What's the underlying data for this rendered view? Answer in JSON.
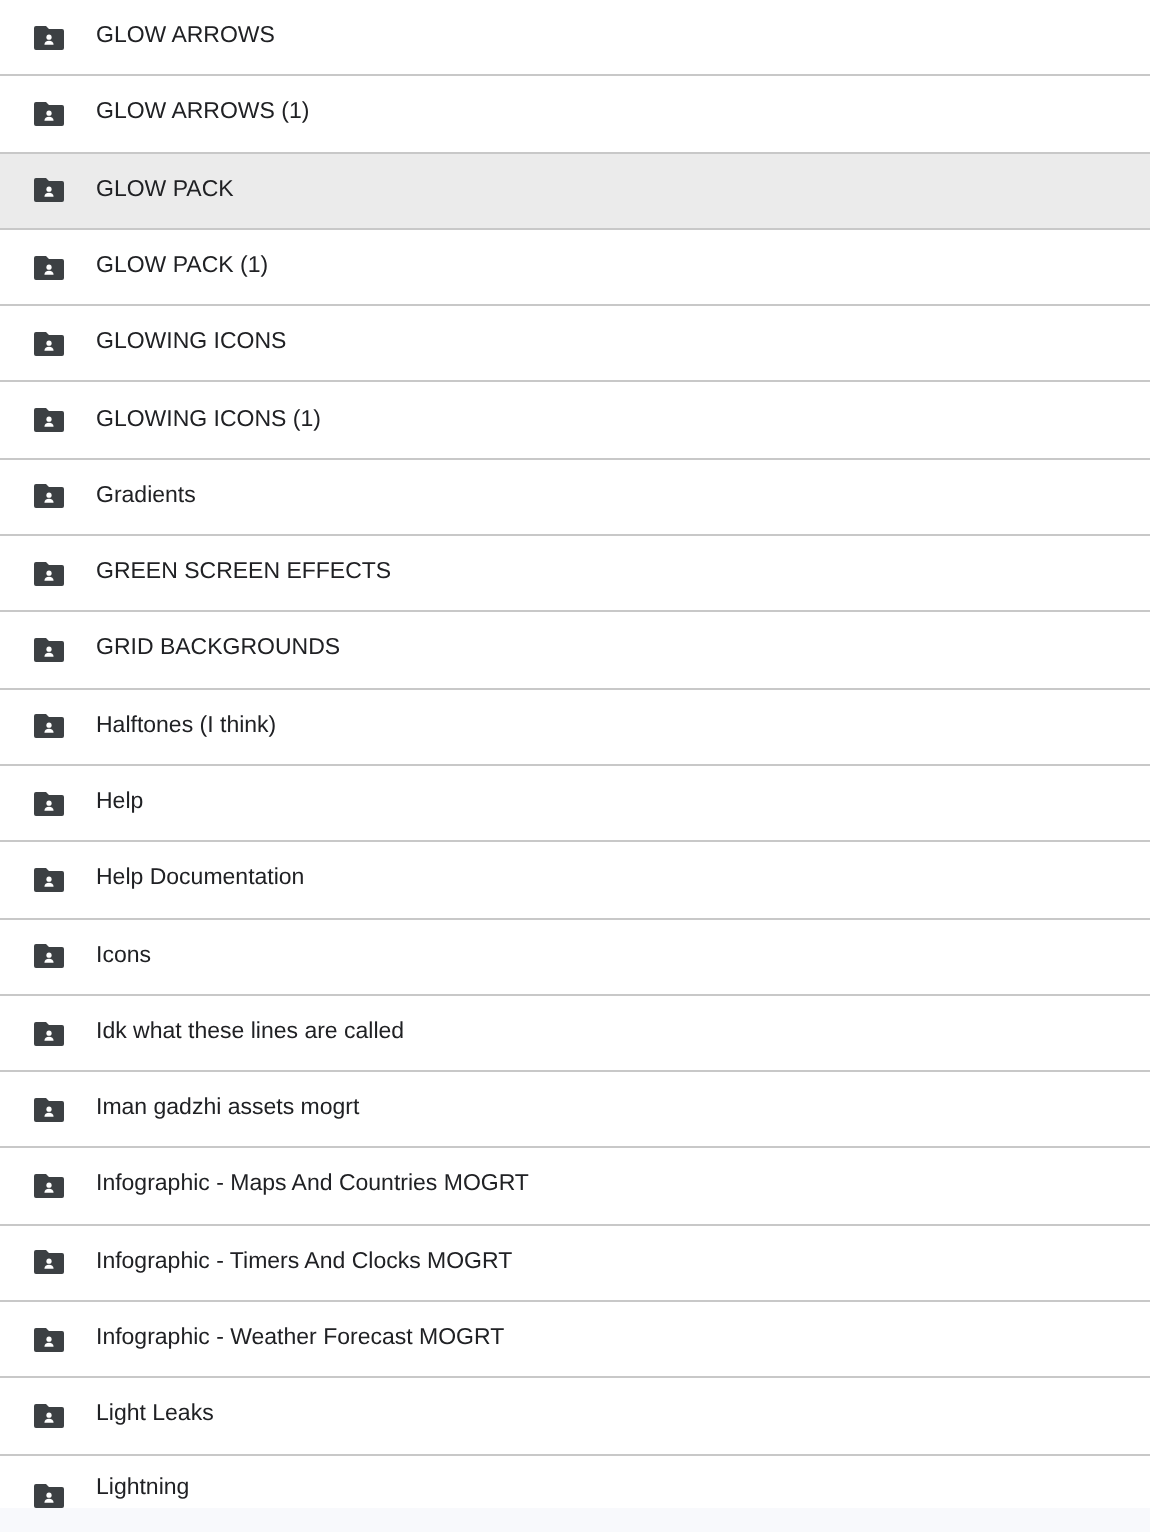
{
  "folders": [
    {
      "name": "GLOW ARROWS",
      "selected": false
    },
    {
      "name": "GLOW ARROWS (1)",
      "selected": false
    },
    {
      "name": "GLOW PACK",
      "selected": true
    },
    {
      "name": "GLOW PACK (1)",
      "selected": false
    },
    {
      "name": "GLOWING ICONS",
      "selected": false
    },
    {
      "name": "GLOWING ICONS (1)",
      "selected": false
    },
    {
      "name": "Gradients",
      "selected": false
    },
    {
      "name": "GREEN SCREEN EFFECTS",
      "selected": false
    },
    {
      "name": "GRID BACKGROUNDS",
      "selected": false
    },
    {
      "name": "Halftones (I think)",
      "selected": false
    },
    {
      "name": "Help",
      "selected": false
    },
    {
      "name": "Help Documentation",
      "selected": false
    },
    {
      "name": "Icons",
      "selected": false
    },
    {
      "name": "Idk what these lines are called",
      "selected": false
    },
    {
      "name": "Iman gadzhi assets mogrt",
      "selected": false
    },
    {
      "name": "Infographic - Maps And Countries MOGRT",
      "selected": false
    },
    {
      "name": "Infographic - Timers And Clocks MOGRT",
      "selected": false
    },
    {
      "name": "Infographic - Weather Forecast MOGRT",
      "selected": false
    },
    {
      "name": "Light Leaks",
      "selected": false
    },
    {
      "name": "Lightning",
      "selected": false
    }
  ]
}
